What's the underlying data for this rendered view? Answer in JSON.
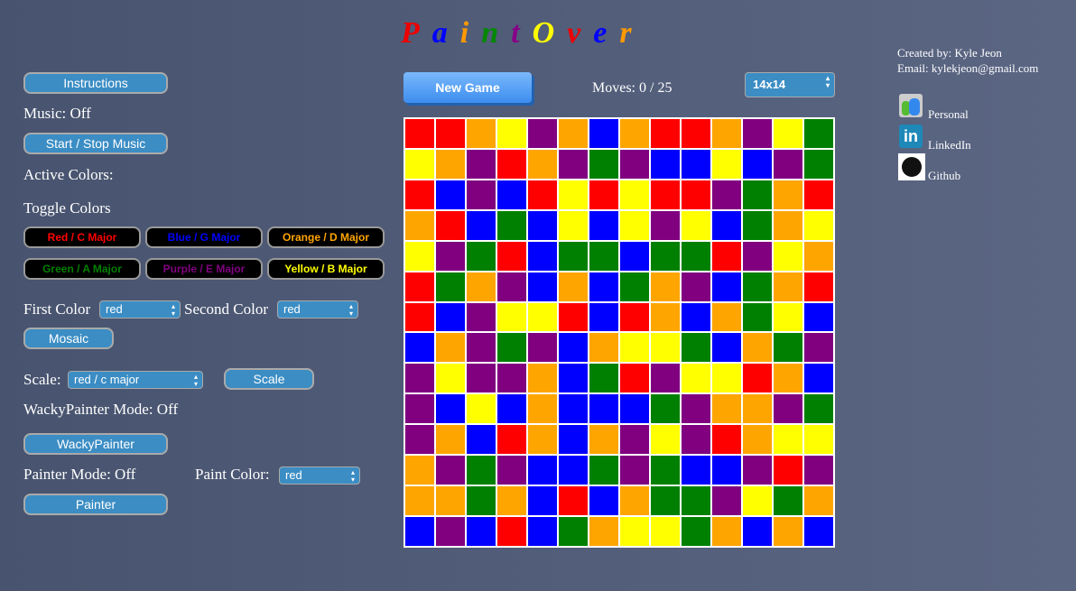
{
  "title": {
    "letters": [
      "P",
      "a",
      "i",
      "n",
      "t",
      "O",
      "v",
      "e",
      "r"
    ],
    "colors": [
      "#e00",
      "#00f",
      "#f90",
      "#080",
      "#808",
      "#ff0",
      "#e00",
      "#00f",
      "#f90"
    ]
  },
  "left": {
    "instructions": "Instructions",
    "music_status": "Music: Off",
    "music_button": "Start / Stop Music",
    "active_colors": "Active Colors:",
    "toggle_colors": "Toggle Colors",
    "toggles": [
      {
        "label": "Red / C Major",
        "color": "#ff0000"
      },
      {
        "label": "Blue / G Major",
        "color": "#0000ff"
      },
      {
        "label": "Orange / D Major",
        "color": "#ffa500"
      },
      {
        "label": "Green / A Major",
        "color": "#008000"
      },
      {
        "label": "Purple / E Major",
        "color": "#800080"
      },
      {
        "label": "Yellow / B Major",
        "color": "#ffff00"
      }
    ],
    "first_color_label": "First Color",
    "first_color": "red",
    "second_color_label": "Second Color",
    "second_color": "red",
    "mosaic": "Mosaic",
    "scale_label": "Scale:",
    "scale_value": "red / c major",
    "scale_button": "Scale",
    "wacky_status": "WackyPainter Mode: Off",
    "wacky_button": "WackyPainter",
    "painter_status": "Painter Mode: Off",
    "paint_color_label": "Paint Color:",
    "paint_color": "red",
    "painter_button": "Painter"
  },
  "game": {
    "new_game": "New Game",
    "moves": "Moves: 0 / 25",
    "size": "14x14",
    "palette": {
      "R": "#ff0000",
      "O": "#ffa500",
      "Y": "#ffff00",
      "G": "#008000",
      "B": "#0000ff",
      "P": "#800080"
    },
    "grid": [
      "RROYPOBORROPYG",
      "YOPROPGPBBYBPG",
      "RBPBRYRYRRPGOR",
      "ORBGBYBYPYBGOY",
      "YPGRBGGBGGRPYO",
      "RGOPBOBGOPBGOR",
      "RBPYYRBROBOGYB",
      "BOPGPBOYYGBOGP",
      "PYPPOBGRPYYROB",
      "PBYBOBBBGPOOPG",
      "POBROBOPYPROYY",
      "OPGPBBGPGBBPRP",
      "OOGOBRBOGGPYGO",
      "BPBRBGOYYGOBOB"
    ]
  },
  "credits": {
    "created": "Created by: Kyle Jeon",
    "email": "Email: kylekjeon@gmail.com",
    "links": [
      "Personal",
      "LinkedIn",
      "Github"
    ]
  }
}
